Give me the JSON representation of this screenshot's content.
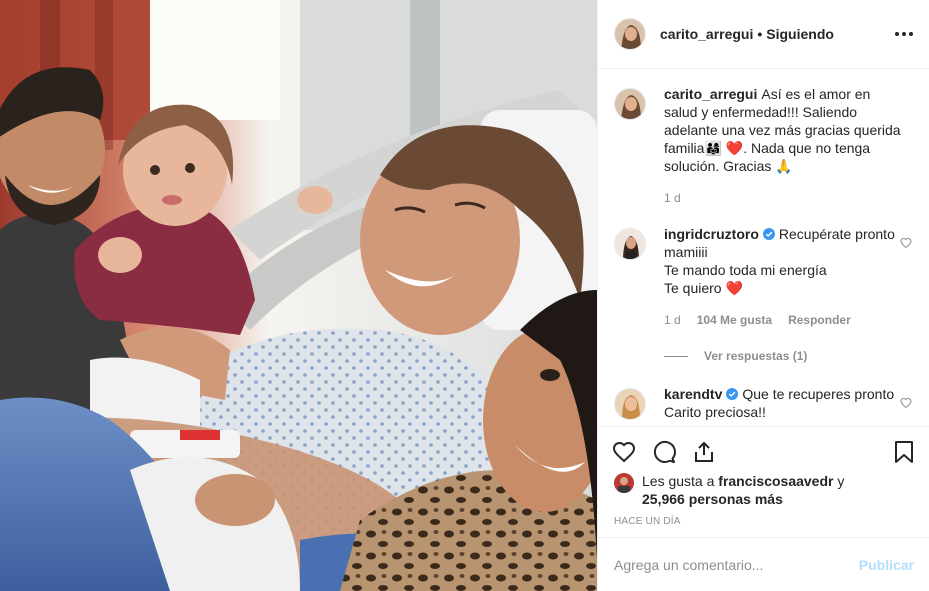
{
  "post": {
    "author": "carito_arregui",
    "separator": "•",
    "follow_status": "Siguiendo",
    "more_label": "More options"
  },
  "caption": {
    "username": "carito_arregui",
    "text": "Así es el amor en salud y enfermedad!!! Saliendo adelante una vez más gracias querida familia👨‍👩‍👧 ❤️. Nada que no tenga solución. Gracias 🙏",
    "time": "1 d"
  },
  "comments": [
    {
      "username": "ingridcruztoro",
      "verified": true,
      "text": "Recupérate pronto mamiiii\nTe mando toda mi energía\nTe quiero ❤️",
      "time": "1 d",
      "likes": "104 Me gusta",
      "reply": "Responder",
      "view_replies": "Ver respuestas (1)"
    },
    {
      "username": "karendtv",
      "verified": true,
      "text": "Que te recuperes pronto Carito preciosa!!"
    }
  ],
  "likes": {
    "prefix": "Les gusta a",
    "user": "franciscosaavedr",
    "conj": "y",
    "count": "25,966 personas más"
  },
  "timestamp": "HACE UN DÍA",
  "add_comment": {
    "placeholder": "Agrega un comentario...",
    "publish": "Publicar"
  },
  "colors": {
    "border": "#efefef",
    "muted": "#8e8e8e",
    "publish_disabled": "#b2dffc",
    "verified": "#3897f0",
    "heart_red": "#ed4956"
  },
  "icons": [
    "heart-icon",
    "comment-icon",
    "share-icon",
    "bookmark-icon",
    "more-icon",
    "verified-icon"
  ]
}
